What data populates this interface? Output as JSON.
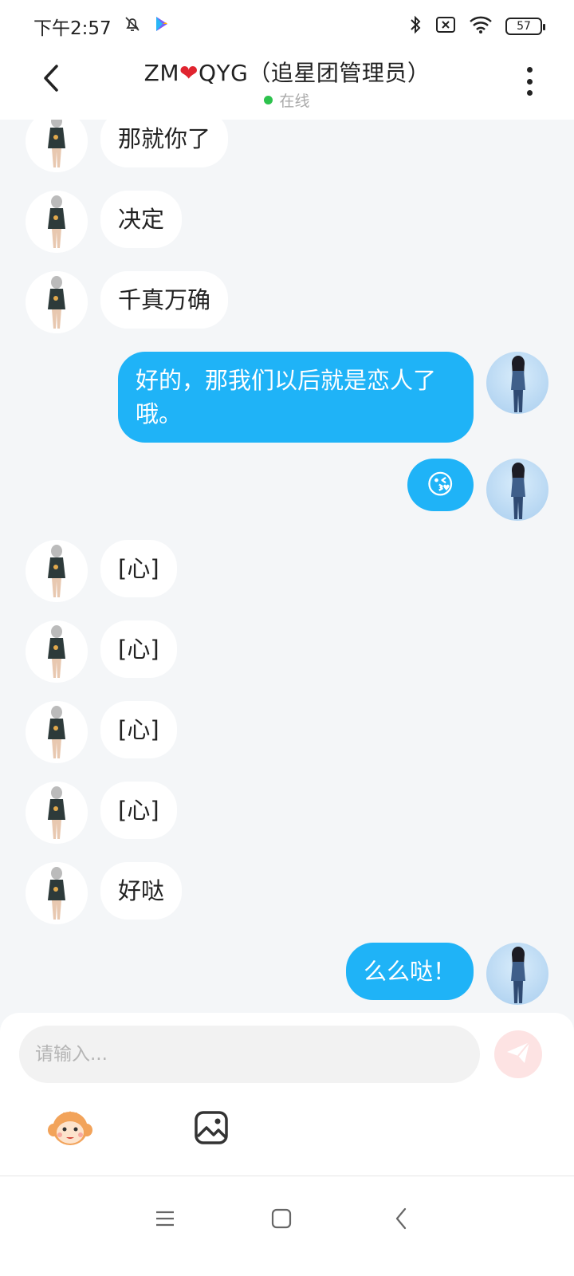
{
  "status_bar": {
    "time": "下午2:57",
    "battery": "57",
    "icons": [
      "bell-off-icon",
      "play-store-icon",
      "bluetooth-icon",
      "no-sim-icon",
      "wifi-icon",
      "battery-icon"
    ]
  },
  "header": {
    "title_left": "ZM",
    "title_heart": "❤",
    "title_right": "QYG（追星团管理员）",
    "status": "在线",
    "status_color": "#2dc24d"
  },
  "messages": [
    {
      "side": "left",
      "text": "那就你了"
    },
    {
      "side": "left",
      "text": "决定"
    },
    {
      "side": "left",
      "text": "千真万确"
    },
    {
      "side": "right",
      "text": "好的，那我们以后就是恋人了哦。"
    },
    {
      "side": "right",
      "text": "😘",
      "emoji": true
    },
    {
      "side": "left",
      "text": "[心]"
    },
    {
      "side": "left",
      "text": "[心]"
    },
    {
      "side": "left",
      "text": "[心]"
    },
    {
      "side": "left",
      "text": "[心]"
    },
    {
      "side": "left",
      "text": "好哒"
    },
    {
      "side": "right",
      "text": "么么哒！"
    }
  ],
  "input": {
    "placeholder": "请输入..."
  },
  "toolbar": {
    "icons": [
      "monkey-emoji-icon",
      "image-icon"
    ]
  },
  "nav_bar": {
    "icons": [
      "menu-icon",
      "home-icon",
      "back-icon"
    ]
  },
  "colors": {
    "self_bubble": "#1fb3f7",
    "other_bubble": "#ffffff",
    "background": "#f4f6f8",
    "send_button": "#fde3e3"
  }
}
